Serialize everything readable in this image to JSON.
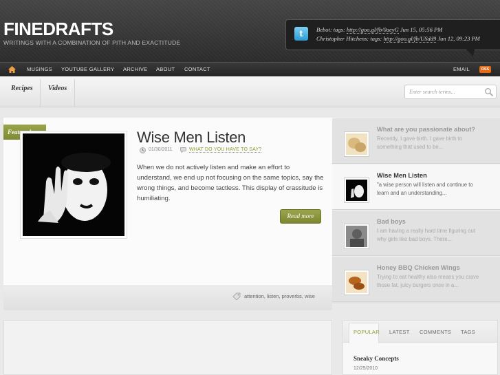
{
  "header": {
    "site_title": "FINEDRAFTS",
    "tagline": "WRITINGS WITH A COMBINATION OF PITH AND EXACTITUDE",
    "tweets": [
      {
        "text": "Bebot: tags: ",
        "link": "http://goo.gl/fb/0aeyG",
        "date": " Jun 15, 05:56 PM"
      },
      {
        "text": "Christopher Hitchens: tags: ",
        "link": "http://goo.gl/fb/USdd9",
        "date": " Jun 12, 09:23 PM"
      }
    ]
  },
  "nav": {
    "items": [
      "MUSINGS",
      "YOUTUBE GALLERY",
      "ARCHIVE",
      "ABOUT",
      "CONTACT"
    ],
    "email": "EMAIL",
    "rss": "RSS"
  },
  "subnav": {
    "categories": [
      "Recipes",
      "Videos"
    ],
    "search_placeholder": "Enter search terms..."
  },
  "featured": {
    "badge": "Featured",
    "title": "Wise Men Listen",
    "date": "01/30/2011",
    "category": "WHAT DO YOU HAVE TO SAY?",
    "excerpt": "When we do not actively listen and make an effort to understand, we end up not focusing on the same topics, say the wrong things, and become tactless. This display of crassitude is humiliating.",
    "read_more": "Read more",
    "tags": "attention, listen, proverbs, wise"
  },
  "sidebar_posts": [
    {
      "title": "What are you passionate about?",
      "desc": "Recently, I gave birth. I gave birth to something that used to be...",
      "thumb": "bread-thumbnail"
    },
    {
      "title": "Wise Men Listen",
      "desc": "\"a wise person will listen and continue to learn and an understanding...",
      "thumb": "mime-thumbnail"
    },
    {
      "title": "Bad boys",
      "desc": "I am having a really hard time figuring out why girls like bad boys. There...",
      "thumb": "bad-boys-thumbnail"
    },
    {
      "title": "Honey BBQ Chicken Wings",
      "desc": "Trying to eat healthy also means you crave those fat, juicy burgers once in a...",
      "thumb": "chicken-wings-thumbnail"
    }
  ],
  "tabs": {
    "items": [
      "POPULAR",
      "LATEST",
      "COMMENTS",
      "TAGS"
    ],
    "popular_title": "Sneaky Concepts",
    "popular_date": "12/25/2010"
  },
  "colors": {
    "accent": "#8a9a2a",
    "header_bg": "#3a3a3a",
    "rss": "#e86a14"
  }
}
